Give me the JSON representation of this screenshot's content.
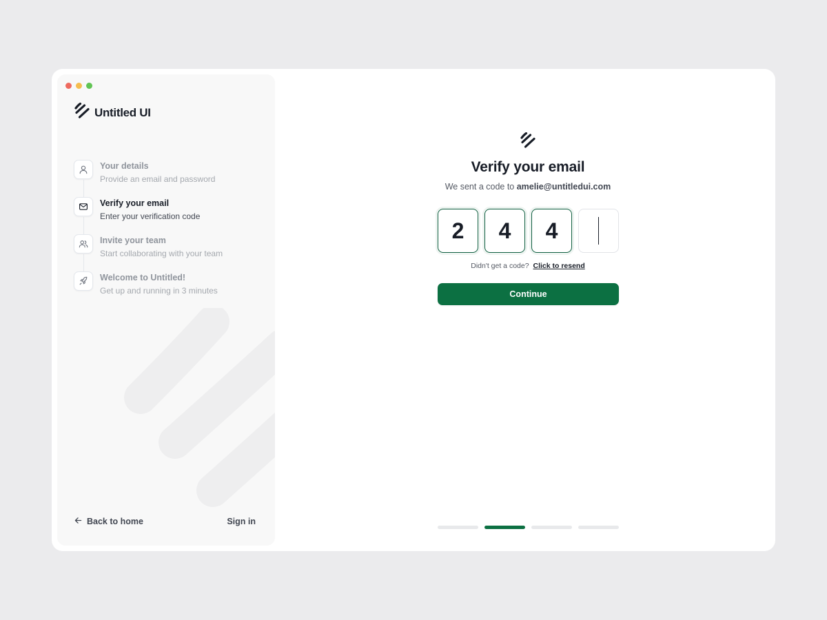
{
  "window": {
    "traffic_lights": [
      {
        "name": "close",
        "color": "#ee6a5f"
      },
      {
        "name": "minimize",
        "color": "#f5bd4f"
      },
      {
        "name": "maximize",
        "color": "#61c454"
      }
    ]
  },
  "brand": {
    "name": "Untitled UI",
    "logo_icon": "untitled-ui-logo-icon"
  },
  "steps": [
    {
      "icon": "user-icon",
      "title": "Your details",
      "description": "Provide an email and password",
      "active": false
    },
    {
      "icon": "mail-icon",
      "title": "Verify your email",
      "description": "Enter your verification code",
      "active": true
    },
    {
      "icon": "users-icon",
      "title": "Invite your team",
      "description": "Start collaborating with your team",
      "active": false
    },
    {
      "icon": "rocket-icon",
      "title": "Welcome to Untitled!",
      "description": "Get up and running in 3 minutes",
      "active": false
    }
  ],
  "sidebar_footer": {
    "back_label": "Back to home",
    "signin_label": "Sign in"
  },
  "verify": {
    "title": "Verify your email",
    "subtitle_prefix": "We sent a code to",
    "email": "amelie@untitledui.com",
    "code_digits": [
      "2",
      "4",
      "4",
      ""
    ],
    "resend_prompt": "Didn't get a code?",
    "resend_link": "Click to resend",
    "continue_label": "Continue"
  },
  "progress": {
    "total_steps": 4,
    "current_step": 2
  },
  "colors": {
    "accent": "#0c7042",
    "input_border_filled": "#0e5e3f",
    "input_border_empty": "#e1e3e7",
    "background": "#ebebed",
    "sidebar_background": "#f8f8f8"
  }
}
